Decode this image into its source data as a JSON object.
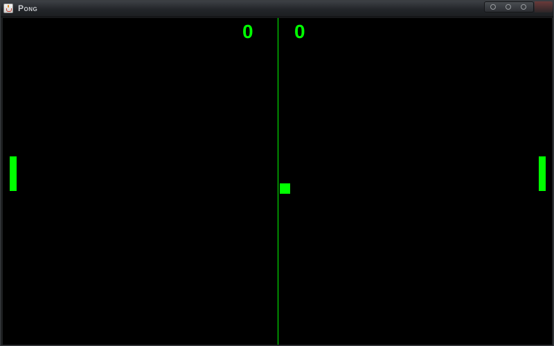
{
  "window": {
    "title": "Pong",
    "app_icon": "java-cup-icon",
    "controls": [
      "minimize-icon",
      "maximize-icon",
      "close-icon"
    ]
  },
  "game": {
    "colors": {
      "foreground": "#00ff00",
      "background": "#000000"
    },
    "score_left": "0",
    "score_right": "0"
  }
}
